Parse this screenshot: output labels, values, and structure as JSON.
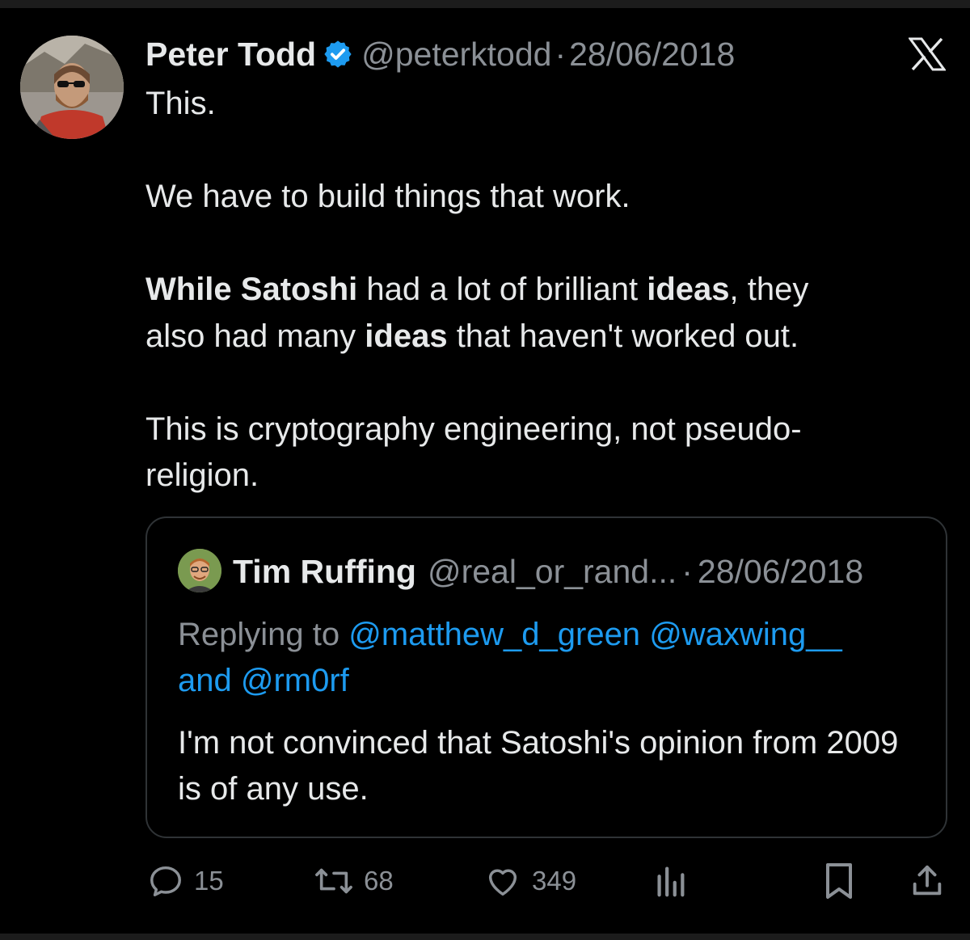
{
  "tweet": {
    "author_name": "Peter Todd",
    "handle": "@peterktodd",
    "separator": "·",
    "date": "28/06/2018",
    "lines": {
      "l1": "This.",
      "l2": "We have to build things that work.",
      "l3_bold1": "While Satoshi",
      "l3_t1": " had a lot of brilliant ",
      "l3_bold2": "ideas",
      "l3_t2": ", they",
      "l4_t1": "also had many ",
      "l4_bold": "ideas",
      "l4_t2": " that haven't worked out.",
      "l5": "This is cryptography engineering, not pseudo-",
      "l6": "religion."
    }
  },
  "quoted": {
    "author_name": "Tim Ruffing",
    "handle": "@real_or_rand...",
    "separator": "·",
    "date": "28/06/2018",
    "replying_prefix": "Replying to ",
    "mention1": "@matthew_d_green",
    "mention2": "@waxwing__",
    "and_mention3": "and @rm0rf",
    "text": "I'm not convinced that Satoshi's opinion from 2009 is of any use."
  },
  "actions": {
    "replies": "15",
    "reposts": "68",
    "likes": "349"
  },
  "icons": {
    "verified": "verified-badge-icon",
    "x_logo": "x-logo-icon",
    "reply": "reply-icon",
    "repost": "repost-icon",
    "like": "heart-icon",
    "views": "views-icon",
    "bookmark": "bookmark-icon",
    "share": "share-icon"
  },
  "colors": {
    "background": "#000000",
    "text": "#e7e9ea",
    "muted": "#8b9096",
    "accent": "#1d9bf0",
    "border": "#2f3336"
  }
}
